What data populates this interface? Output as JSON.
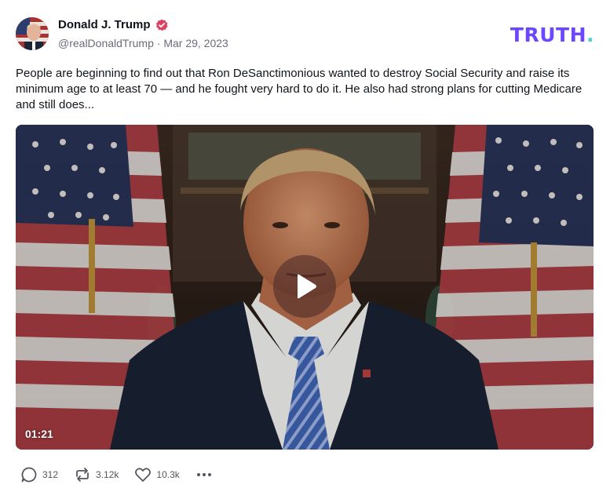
{
  "post": {
    "author_name": "Donald J. Trump",
    "handle": "@realDonaldTrump",
    "separator": "·",
    "date": "Mar 29, 2023",
    "brand_main": "TRUTH",
    "brand_dot": ".",
    "text": "People are beginning to find out that Ron DeSanctimonious wanted to destroy Social Security and raise its minimum age to at least 70 — and he fought very hard to do it. He also had strong plans for cutting Medicare and still does...",
    "video": {
      "duration": "01:21"
    },
    "actions": {
      "replies": "312",
      "retruths": "3.12k",
      "likes": "10.3k"
    }
  },
  "icons": {
    "verified": "verified-badge-icon",
    "play": "play-icon",
    "reply": "reply-bubble-icon",
    "retruth": "retruth-arrows-icon",
    "like": "heart-icon",
    "more": "more-dots-icon"
  },
  "colors": {
    "brand": "#6c47ff",
    "brand_dot": "#4cd5d0",
    "verified": "#e0405f",
    "muted_text": "#6b6b7b"
  }
}
